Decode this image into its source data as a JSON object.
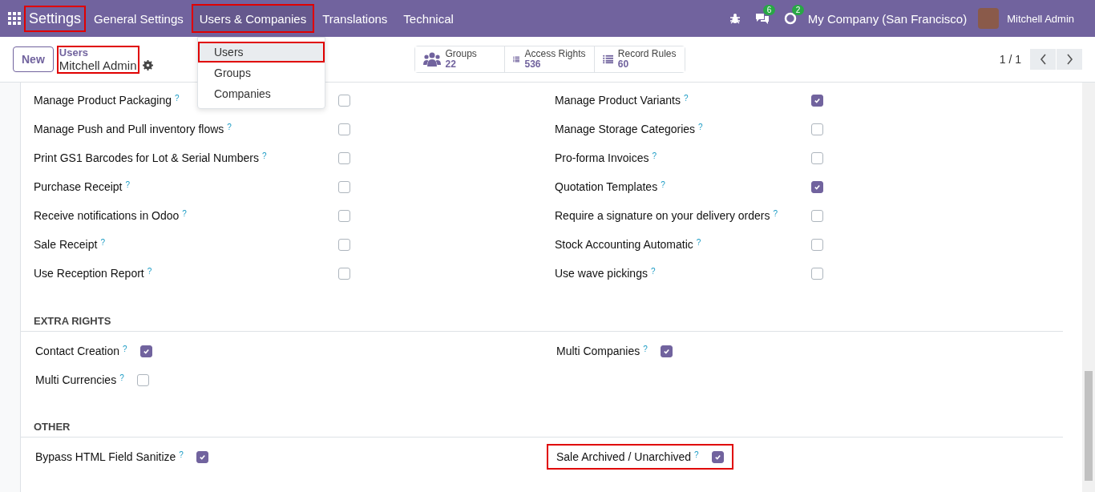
{
  "navbar": {
    "app_title": {
      "text": "Settings",
      "highlighted": true
    },
    "menus": [
      {
        "label": "General Settings",
        "highlighted": false,
        "open": false
      },
      {
        "label": "Users & Companies",
        "highlighted": true,
        "open": true
      },
      {
        "label": "Translations",
        "highlighted": false,
        "open": false
      },
      {
        "label": "Technical",
        "highlighted": false,
        "open": false
      }
    ],
    "messages_badge": "6",
    "activities_badge": "2",
    "company": "My Company (San Francisco)",
    "user": "Mitchell Admin"
  },
  "dropdown": {
    "items": [
      {
        "label": "Users",
        "selected": true,
        "highlighted": true
      },
      {
        "label": "Groups",
        "selected": false,
        "highlighted": false
      },
      {
        "label": "Companies",
        "selected": false,
        "highlighted": false
      }
    ]
  },
  "control_panel": {
    "new_button": "New",
    "breadcrumb": {
      "parent": "Users",
      "current": "Mitchell Admin",
      "highlighted": true
    },
    "smart_buttons": [
      {
        "kind": "groups",
        "label": "Groups",
        "count": "22"
      },
      {
        "kind": "list",
        "label": "Access Rights",
        "count": "536"
      },
      {
        "kind": "list",
        "label": "Record Rules",
        "count": "60"
      }
    ],
    "pager": "1 / 1"
  },
  "sections": [
    {
      "kind": "grid",
      "fields": [
        {
          "label": "Manage Product Packaging",
          "help": "?",
          "checked": false,
          "highlighted": false
        },
        {
          "label": "Manage Product Variants",
          "help": "?",
          "checked": true,
          "highlighted": false
        },
        {
          "label": "Manage Push and Pull inventory flows",
          "help": "?",
          "checked": false,
          "highlighted": false
        },
        {
          "label": "Manage Storage Categories",
          "help": "?",
          "checked": false,
          "highlighted": false
        },
        {
          "label": "Print GS1 Barcodes for Lot & Serial Numbers",
          "help": "?",
          "checked": false,
          "highlighted": false
        },
        {
          "label": "Pro-forma Invoices",
          "help": "?",
          "checked": false,
          "highlighted": false
        },
        {
          "label": "Purchase Receipt",
          "help": "?",
          "checked": false,
          "highlighted": false
        },
        {
          "label": "Quotation Templates",
          "help": "?",
          "checked": true,
          "highlighted": false
        },
        {
          "label": "Receive notifications in Odoo",
          "help": "?",
          "checked": false,
          "highlighted": false
        },
        {
          "label": "Require a signature on your delivery orders",
          "help": "?",
          "checked": false,
          "highlighted": false
        },
        {
          "label": "Sale Receipt",
          "help": "?",
          "checked": false,
          "highlighted": false
        },
        {
          "label": "Stock Accounting Automatic",
          "help": "?",
          "checked": false,
          "highlighted": false
        },
        {
          "label": "Use Reception Report",
          "help": "?",
          "checked": false,
          "highlighted": false
        },
        {
          "label": "Use wave pickings",
          "help": "?",
          "checked": false,
          "highlighted": false
        }
      ]
    },
    {
      "kind": "inline",
      "title": "EXTRA RIGHTS",
      "fields": [
        {
          "label": "Contact Creation",
          "help": "?",
          "checked": true,
          "highlighted": false
        },
        {
          "label": "Multi Companies",
          "help": "?",
          "checked": true,
          "highlighted": false
        },
        {
          "label": "Multi Currencies",
          "help": "?",
          "checked": false,
          "highlighted": false
        }
      ]
    },
    {
      "kind": "inline",
      "title": "OTHER",
      "fields": [
        {
          "label": "Bypass HTML Field Sanitize",
          "help": "?",
          "checked": true,
          "highlighted": false
        },
        {
          "label": "Sale Archived / Unarchived",
          "help": "?",
          "checked": true,
          "highlighted": true
        }
      ]
    }
  ]
}
